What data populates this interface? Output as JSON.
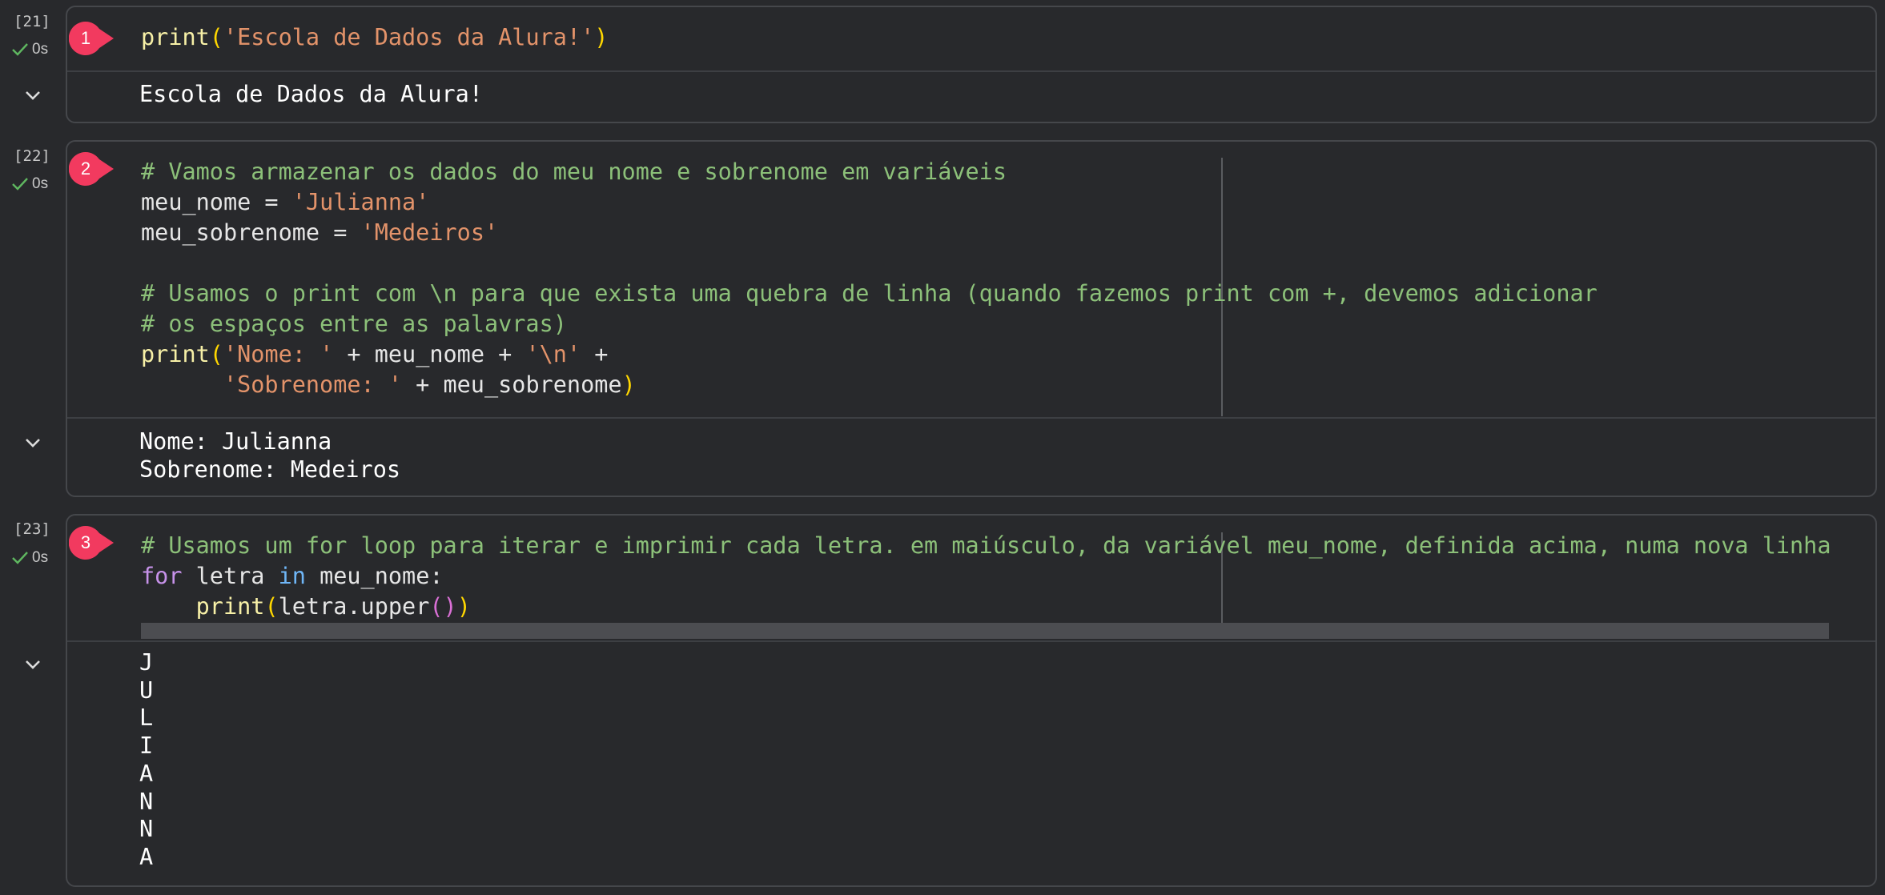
{
  "cells": [
    {
      "count": "[21]",
      "status": "0s",
      "badge": "1",
      "code": [
        [
          {
            "t": "print",
            "c": "fn"
          },
          {
            "t": "(",
            "c": "pa"
          },
          {
            "t": "'Escola de Dados da Alura!'",
            "c": "st"
          },
          {
            "t": ")",
            "c": "pa"
          }
        ]
      ],
      "output": [
        "Escola de Dados da Alura!"
      ]
    },
    {
      "count": "[22]",
      "status": "0s",
      "badge": "2",
      "code": [
        [
          {
            "t": "# Vamos armazenar os dados do meu nome e sobrenome em variáveis",
            "c": "cm"
          }
        ],
        [
          {
            "t": "meu_nome = ",
            "c": "nm"
          },
          {
            "t": "'Julianna'",
            "c": "st"
          }
        ],
        [
          {
            "t": "meu_sobrenome = ",
            "c": "nm"
          },
          {
            "t": "'Medeiros'",
            "c": "st"
          }
        ],
        [],
        [
          {
            "t": "# Usamos o print com \\n para que exista uma quebra de linha (quando fazemos print com +, devemos adicionar",
            "c": "cm"
          }
        ],
        [
          {
            "t": "# os espaços entre as palavras)",
            "c": "cm"
          }
        ],
        [
          {
            "t": "print",
            "c": "fn"
          },
          {
            "t": "(",
            "c": "pa"
          },
          {
            "t": "'Nome: '",
            "c": "st"
          },
          {
            "t": " + meu_nome + ",
            "c": "nm"
          },
          {
            "t": "'\\n'",
            "c": "st"
          },
          {
            "t": " +",
            "c": "nm"
          }
        ],
        [
          {
            "t": "      ",
            "c": "nm"
          },
          {
            "t": "'Sobrenome: '",
            "c": "st"
          },
          {
            "t": " + meu_sobrenome",
            "c": "nm"
          },
          {
            "t": ")",
            "c": "pa"
          }
        ]
      ],
      "output": [
        "Nome: Julianna",
        "Sobrenome: Medeiros"
      ]
    },
    {
      "count": "[23]",
      "status": "0s",
      "badge": "3",
      "code": [
        [
          {
            "t": "# Usamos um for loop para iterar e imprimir cada letra. em maiúsculo, da variável meu_nome, definida acima, numa nova linha",
            "c": "cm"
          }
        ],
        [
          {
            "t": "for",
            "c": "kw"
          },
          {
            "t": " letra ",
            "c": "nm"
          },
          {
            "t": "in",
            "c": "kw2"
          },
          {
            "t": " meu_nome:",
            "c": "nm"
          }
        ],
        [
          {
            "t": "    ",
            "c": "nm"
          },
          {
            "t": "print",
            "c": "fn"
          },
          {
            "t": "(",
            "c": "pa"
          },
          {
            "t": "letra.upper",
            "c": "nm"
          },
          {
            "t": "()",
            "c": "pb"
          },
          {
            "t": ")",
            "c": "pa"
          }
        ]
      ],
      "output": [
        "J",
        "U",
        "L",
        "I",
        "A",
        "N",
        "N",
        "A"
      ]
    }
  ],
  "colors": {
    "background": "#28292c",
    "border": "#45474b",
    "badge": "#f23a5f",
    "success": "#5fb760",
    "comment": "#8cc079",
    "string": "#e3936a",
    "function": "#f7f0a7"
  },
  "icons": {
    "status": "check-icon",
    "collapse": "chevron-down-icon"
  }
}
